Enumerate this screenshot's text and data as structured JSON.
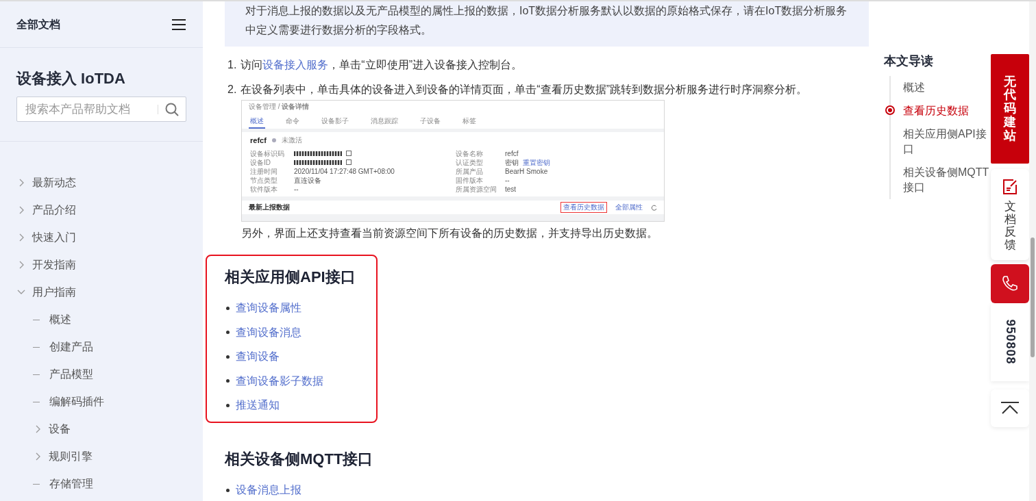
{
  "sidebar": {
    "header": "全部文档",
    "product_title": "设备接入 IoTDA",
    "search": {
      "placeholder": "搜索本产品帮助文档"
    },
    "items": [
      {
        "label": "最新动态",
        "kind": "folder",
        "expanded": false
      },
      {
        "label": "产品介绍",
        "kind": "folder",
        "expanded": false
      },
      {
        "label": "快速入门",
        "kind": "folder",
        "expanded": false
      },
      {
        "label": "开发指南",
        "kind": "folder",
        "expanded": false
      },
      {
        "label": "用户指南",
        "kind": "folder",
        "expanded": true,
        "children": [
          {
            "label": "概述",
            "kind": "leaf"
          },
          {
            "label": "创建产品",
            "kind": "leaf"
          },
          {
            "label": "产品模型",
            "kind": "leaf"
          },
          {
            "label": "编解码插件",
            "kind": "leaf"
          },
          {
            "label": "设备",
            "kind": "folder",
            "expanded": false
          },
          {
            "label": "规则引擎",
            "kind": "folder",
            "expanded": false
          },
          {
            "label": "存储管理",
            "kind": "leaf"
          }
        ]
      }
    ]
  },
  "content": {
    "note": "对于消息上报的数据以及无产品模型的属性上报的数据，IoT数据分析服务默认以数据的原始格式保存，请在IoT数据分析服务中定义需要进行数据分析的字段格式。",
    "steps": [
      {
        "number": "1.",
        "before": "访问",
        "link": "设备接入服务",
        "after": "，单击“立即使用”进入设备接入控制台。"
      },
      {
        "number": "2.",
        "before": "在设备列表中，单击具体的设备进入到设备的详情页面，单击“查看历史数据”跳转到数据分析服务进行时序洞察分析。"
      }
    ],
    "screenshot": {
      "breadcrumb": "设备管理 / **设备详情**",
      "tabs": [
        {
          "label": "概述",
          "selected": true
        },
        {
          "label": "命令",
          "selected": false
        },
        {
          "label": "设备影子",
          "selected": false
        },
        {
          "label": "消息跟踪",
          "selected": false
        },
        {
          "label": "子设备",
          "selected": false
        },
        {
          "label": "标签",
          "selected": false
        }
      ],
      "device_name": "refcf",
      "status": "未激活",
      "fields_left": [
        {
          "label": "设备标识码",
          "masked": true
        },
        {
          "label": "设备ID",
          "masked": true
        },
        {
          "label": "注册时间",
          "value": "2020/11/04 17:27:48 GMT+08:00"
        },
        {
          "label": "节点类型",
          "value": "直连设备"
        },
        {
          "label": "软件版本",
          "value": "--"
        }
      ],
      "fields_right": [
        {
          "label": "设备名称",
          "value": "refcf"
        },
        {
          "label": "认证类型",
          "value": "密钥",
          "link": "重置密钥"
        },
        {
          "label": "所属产品",
          "value": "BearH Smoke"
        },
        {
          "label": "固件版本",
          "value": "--"
        },
        {
          "label": "所属资源空间",
          "value": "test"
        }
      ],
      "section_title": "最新上报数据",
      "actions": [
        {
          "label": "查看历史数据",
          "highlighted": true
        },
        {
          "label": "全部属性",
          "highlighted": false
        }
      ]
    },
    "after_text": "另外，界面上还支持查看当前资源空间下所有设备的历史数据，并支持导出历史数据。",
    "sections": [
      {
        "title": "相关应用侧API接口",
        "highlighted": true,
        "links": [
          "查询设备属性",
          "查询设备消息",
          "查询设备",
          "查询设备影子数据",
          "推送通知"
        ]
      },
      {
        "title": "相关设备侧MQTT接口",
        "highlighted": false,
        "links": [
          "设备消息上报"
        ]
      }
    ]
  },
  "toc": {
    "title": "本文导读",
    "items": [
      {
        "label": "概述",
        "selected": false
      },
      {
        "label": "查看历史数据",
        "selected": true
      },
      {
        "label": "相关应用侧API接口",
        "selected": false
      },
      {
        "label": "相关设备侧MQTT接口",
        "selected": false
      }
    ]
  },
  "float_panel": {
    "promo": "无代码建站",
    "feedback": "文档反馈",
    "hotline": "950808"
  }
}
